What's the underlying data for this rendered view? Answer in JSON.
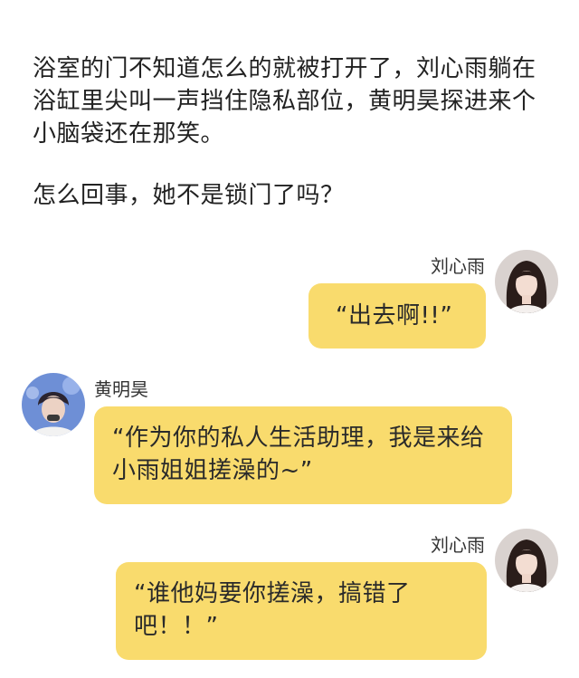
{
  "narration": {
    "paragraph1": "浴室的门不知道怎么的就被打开了，刘心雨躺在浴缸里尖叫一声挡住隐私部位，黄明昊探进来个小脑袋还在那笑。",
    "paragraph2": "怎么回事，她不是锁门了吗？"
  },
  "messages": [
    {
      "sender": "刘心雨",
      "side": "right",
      "text": "“出去啊!!”",
      "avatar": "avatar-liu-xinyu"
    },
    {
      "sender": "黄明昊",
      "side": "left",
      "text": "“作为你的私人生活助理，我是来给小雨姐姐搓澡的~”",
      "avatar": "avatar-huang-minghao"
    },
    {
      "sender": "刘心雨",
      "side": "right",
      "text": "“谁他妈要你搓澡，搞错了吧！！”",
      "avatar": "avatar-liu-xinyu"
    }
  ],
  "colors": {
    "bubble": "#f9db6d",
    "background": "#ffffff",
    "text": "#222222"
  }
}
